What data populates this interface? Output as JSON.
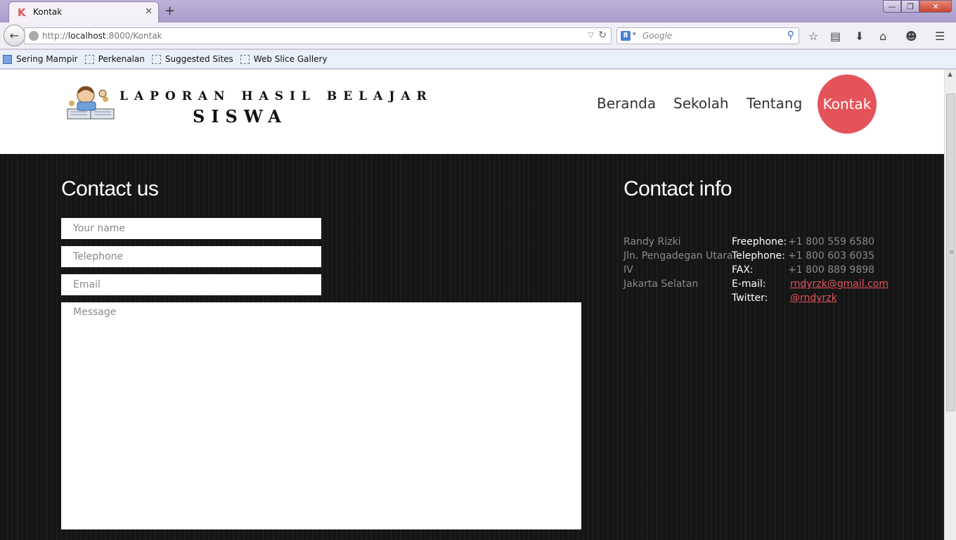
{
  "browser": {
    "tab_title": "Kontak",
    "tab_favicon": "K",
    "url_domain_prefix": "http://",
    "url_host": "localhost",
    "url_rest": ":8000/Kontak",
    "search_placeholder": "Google",
    "bookmarks": [
      "Sering Mampir",
      "Perkenalan",
      "Suggested Sites",
      "Web Slice Gallery"
    ]
  },
  "header": {
    "logo_line1": "LAPORAN HASIL BELAJAR",
    "logo_line2": "SISWA",
    "nav": [
      "Beranda",
      "Sekolah",
      "Tentang",
      "Kontak"
    ],
    "active_nav": "Kontak",
    "accent_color": "#e5535a"
  },
  "contact_form": {
    "heading": "Contact us",
    "name_placeholder": "Your name",
    "telephone_placeholder": "Telephone",
    "email_placeholder": "Email",
    "message_placeholder": "Message"
  },
  "contact_info": {
    "heading": "Contact info",
    "address": [
      "Randy Rizki",
      "Jln. Pengadegan Utara",
      "IV",
      "Jakarta Selatan"
    ],
    "freephone_label": "Freephone:",
    "freephone": "+1 800 559 6580",
    "telephone_label": "Telephone:",
    "telephone": "+1 800 603 6035",
    "fax_label": "FAX:",
    "fax": "+1 800 889 9898",
    "email_label": "E-mail:",
    "email": "rndyrzk@gmail.com",
    "twitter_label": "Twitter:",
    "twitter": "@rndyrzk"
  }
}
